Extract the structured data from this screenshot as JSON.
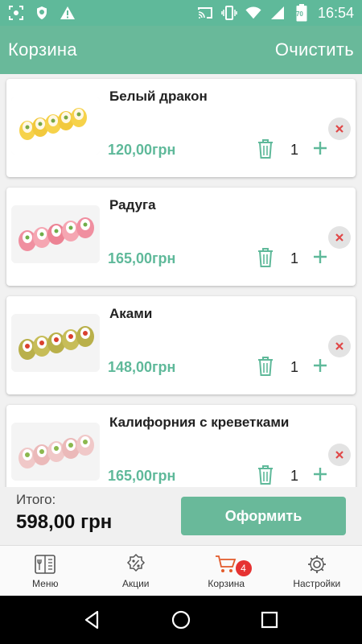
{
  "status_bar": {
    "time": "16:54",
    "battery_level": "70",
    "icons": [
      "screenshot-icon",
      "shield-icon",
      "warning-icon",
      "cast-icon",
      "vibrate-icon",
      "wifi-icon",
      "signal-icon",
      "battery-icon"
    ]
  },
  "header": {
    "title": "Корзина",
    "clear_label": "Очистить"
  },
  "cart": {
    "items": [
      {
        "name": "Белый дракон",
        "price": "120,00грн",
        "qty": "1"
      },
      {
        "name": "Радуга",
        "price": "165,00грн",
        "qty": "1"
      },
      {
        "name": "Аками",
        "price": "148,00грн",
        "qty": "1"
      },
      {
        "name": "Калифорния с креветками",
        "price": "165,00грн",
        "qty": "1"
      }
    ]
  },
  "footer": {
    "total_label": "Итого:",
    "total_value": "598,00 грн",
    "checkout_label": "Оформить"
  },
  "bottom_nav": {
    "items": [
      {
        "label": "Меню",
        "icon": "menu-book-icon"
      },
      {
        "label": "Акции",
        "icon": "discount-icon"
      },
      {
        "label": "Корзина",
        "icon": "cart-icon"
      },
      {
        "label": "Настройки",
        "icon": "gear-icon"
      }
    ],
    "cart_badge": "4"
  },
  "colors": {
    "primary": "#69b99a",
    "status_bar": "#5fb99a",
    "price": "#5fb99a",
    "badge": "#e63232",
    "remove_x": "#e04848"
  }
}
